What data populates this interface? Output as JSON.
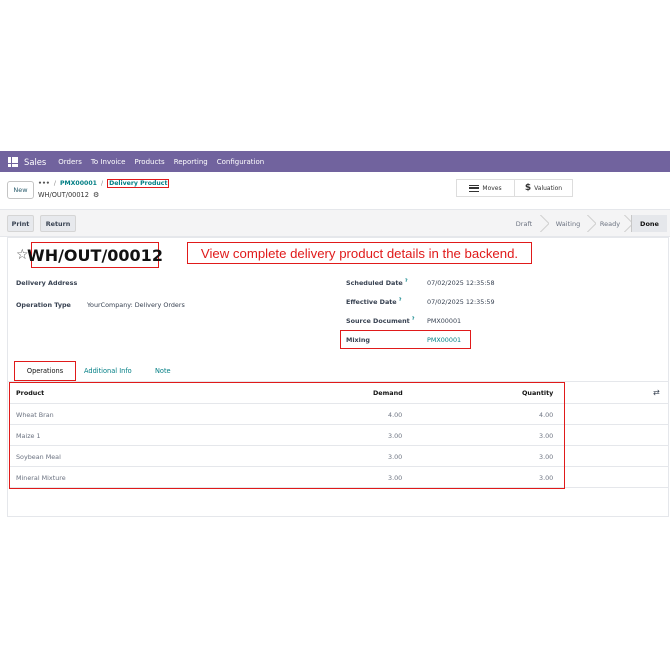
{
  "navbar": {
    "app_name": "Sales",
    "menu": [
      "Orders",
      "To Invoice",
      "Products",
      "Reporting",
      "Configuration"
    ],
    "bg_color": "#71639e"
  },
  "control_panel": {
    "new_label": "New",
    "breadcrumb": {
      "dots": "•••",
      "separator": "/",
      "parent": "PMX00001",
      "current": "Delivery Product"
    },
    "record_ref": "WH/OUT/00012",
    "moves_label": "Moves",
    "valuation_label": "Valuation"
  },
  "statusbar": {
    "print_label": "Print",
    "return_label": "Return",
    "stages": [
      "Draft",
      "Waiting",
      "Ready",
      "Done"
    ],
    "active_stage": "Done"
  },
  "form": {
    "title": "WH/OUT/00012",
    "callout": "View complete delivery product details in the backend.",
    "left_fields": [
      {
        "label": "Delivery Address",
        "value": ""
      },
      {
        "label": "Operation Type",
        "value": "YourCompany: Delivery Orders"
      }
    ],
    "right_fields": [
      {
        "label": "Scheduled Date",
        "help": "?",
        "value": "07/02/2025 12:35:58"
      },
      {
        "label": "Effective Date",
        "help": "?",
        "value": "07/02/2025 12:35:59"
      },
      {
        "label": "Source Document",
        "help": "?",
        "value": "PMX00001"
      },
      {
        "label": "Mixing",
        "value": "PMX00001"
      }
    ]
  },
  "tabs": [
    "Operations",
    "Additional Info",
    "Note"
  ],
  "operations": {
    "columns": [
      "Product",
      "Demand",
      "Quantity"
    ],
    "rows": [
      {
        "product": "Wheat Bran",
        "demand": "4.00",
        "quantity": "4.00"
      },
      {
        "product": "Maize 1",
        "demand": "3.00",
        "quantity": "3.00"
      },
      {
        "product": "Soybean Meal",
        "demand": "3.00",
        "quantity": "3.00"
      },
      {
        "product": "Mineral Mixture",
        "demand": "3.00",
        "quantity": "3.00"
      }
    ]
  },
  "colors": {
    "accent": "#017e84",
    "highlight": "#e01a1a"
  }
}
